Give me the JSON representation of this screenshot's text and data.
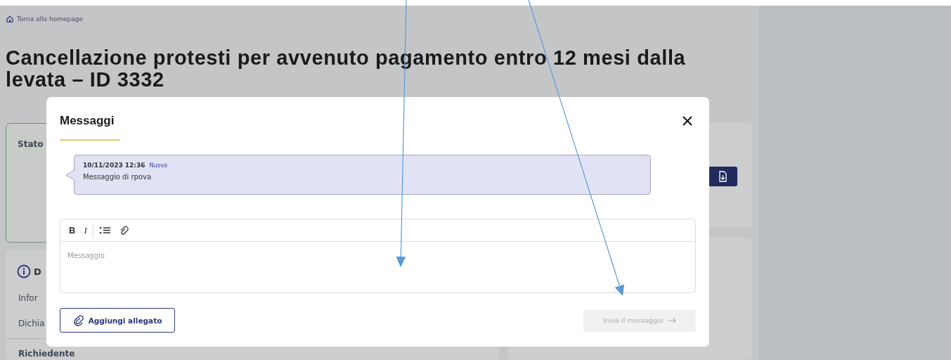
{
  "page": {
    "back_link": "Torna alla homepage",
    "title": "Cancellazione protesti per avvenuto pagamento entro 12 mesi dalla levata – ID 3332",
    "status_card": {
      "label": "Stato"
    },
    "details_card": {
      "heading": "D",
      "rows": [
        "Infor",
        "Dichia"
      ],
      "section": "Richiedente"
    }
  },
  "modal": {
    "title": "Messaggi",
    "messages": [
      {
        "date": "10/11/2023 12:36",
        "badge": "Nuovo",
        "text": "Messaggio di rpova"
      }
    ],
    "editor": {
      "tools": [
        {
          "kind": "bold",
          "label": "B"
        },
        {
          "kind": "italic",
          "label": "I"
        },
        {
          "kind": "list"
        },
        {
          "kind": "link"
        }
      ],
      "placeholder": "Messaggio"
    },
    "attach_button": "Aggiungi allegato",
    "send_button": {
      "label": "Invia il messaggio",
      "disabled": true
    }
  },
  "annotations": [
    {
      "kind": "arrow"
    },
    {
      "kind": "arrow"
    }
  ]
}
